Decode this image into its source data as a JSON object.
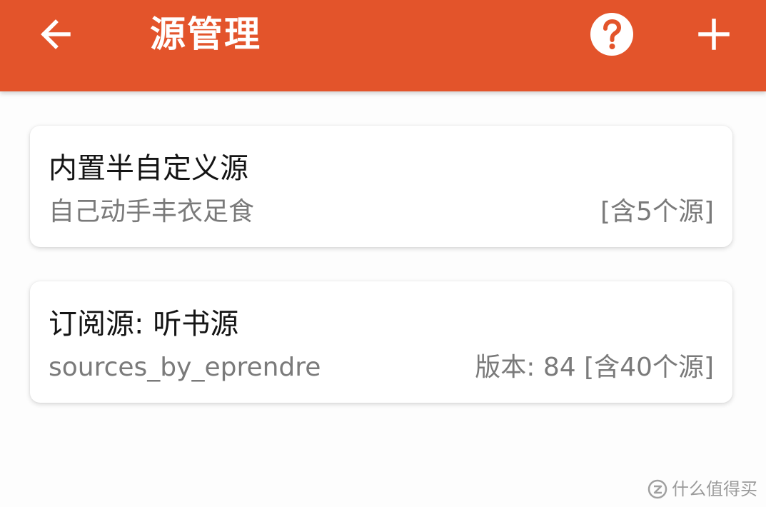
{
  "header": {
    "title": "源管理",
    "back_icon": "arrow-left-icon",
    "help_icon": "help-circle-icon",
    "add_icon": "plus-icon",
    "background_color": "#e3542b"
  },
  "cards": [
    {
      "title": "内置半自定义源",
      "subtitle": "自己动手丰衣足食",
      "right_text": "[含5个源]"
    },
    {
      "title": "订阅源: 听书源",
      "subtitle": "sources_by_eprendre",
      "right_text": "版本: 84 [含40个源]"
    }
  ],
  "watermark": {
    "text": "什么值得买",
    "icon": "smzdm-logo-icon"
  }
}
